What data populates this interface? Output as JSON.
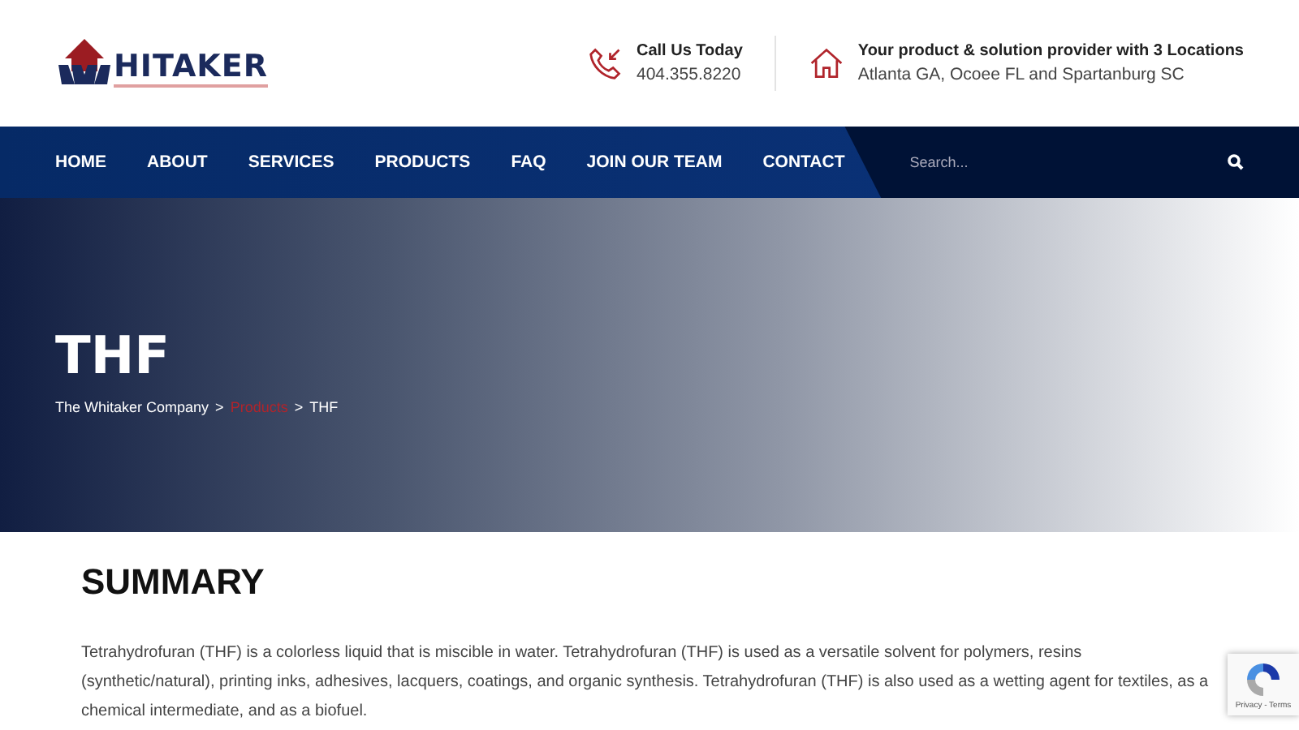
{
  "logo": {
    "text": "HITAKER"
  },
  "contacts": [
    {
      "kind": "phone",
      "title": "Call Us Today",
      "detail": "404.355.8220"
    },
    {
      "kind": "home",
      "title": "Your product & solution provider with 3 Locations",
      "detail": "Atlanta GA, Ocoee FL and Spartanburg SC"
    }
  ],
  "nav": [
    {
      "label": "HOME"
    },
    {
      "label": "ABOUT"
    },
    {
      "label": "SERVICES"
    },
    {
      "label": "PRODUCTS"
    },
    {
      "label": "FAQ"
    },
    {
      "label": "JOIN OUR TEAM"
    },
    {
      "label": "CONTACT"
    }
  ],
  "search": {
    "placeholder": "Search..."
  },
  "hero": {
    "title": "THF",
    "separator": ">",
    "breadcrumb": [
      {
        "label": "The Whitaker Company",
        "kind": "link"
      },
      {
        "label": "Products",
        "kind": "highlight"
      },
      {
        "label": "THF",
        "kind": "current"
      }
    ]
  },
  "summary": {
    "heading": "SUMMARY",
    "text": "Tetrahydrofuran (THF) is a colorless liquid that is miscible in water. Tetrahydrofuran (THF) is used as a versatile solvent for polymers, resins (synthetic/natural), printing inks, adhesives, lacquers, coatings, and organic synthesis. Tetrahydrofuran (THF) is also used as a wetting agent for textiles, as a chemical intermediate, and as a biofuel."
  },
  "recaptcha": {
    "text": "Privacy - Terms"
  }
}
